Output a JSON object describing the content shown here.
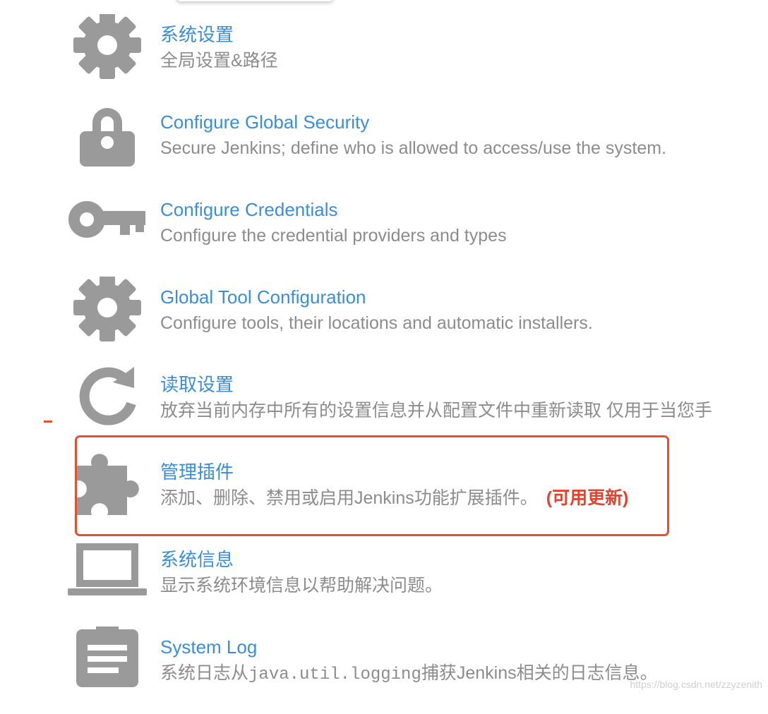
{
  "items": [
    {
      "title": "系统设置",
      "desc": "全局设置&路径",
      "icon": "gear-icon"
    },
    {
      "title": "Configure Global Security",
      "desc": "Secure Jenkins; define who is allowed to access/use the system.",
      "icon": "lock-icon"
    },
    {
      "title": "Configure Credentials",
      "desc": "Configure the credential providers and types",
      "icon": "key-icon"
    },
    {
      "title": "Global Tool Configuration",
      "desc": "Configure tools, their locations and automatic installers.",
      "icon": "gear-icon"
    },
    {
      "title": "读取设置",
      "desc": "放弃当前内存中所有的设置信息并从配置文件中重新读取 仅用于当您手",
      "icon": "reload-icon"
    },
    {
      "title": "管理插件",
      "desc": "添加、删除、禁用或启用Jenkins功能扩展插件。",
      "badge": "(可用更新)",
      "icon": "puzzle-icon"
    },
    {
      "title": "系统信息",
      "desc": "显示系统环境信息以帮助解决问题。",
      "icon": "laptop-icon"
    },
    {
      "title": "System Log",
      "desc_prefix": "系统日志从",
      "desc_code": "java.util.logging",
      "desc_suffix": "捕获Jenkins相关的日志信息。",
      "icon": "clipboard-icon"
    }
  ],
  "watermark": "https://blog.csdn.net/zzyzenith",
  "colors": {
    "link": "#3a8ed8",
    "desc": "#8c8c8c",
    "icon": "#9a9a9a",
    "highlight": "#e4512e"
  }
}
